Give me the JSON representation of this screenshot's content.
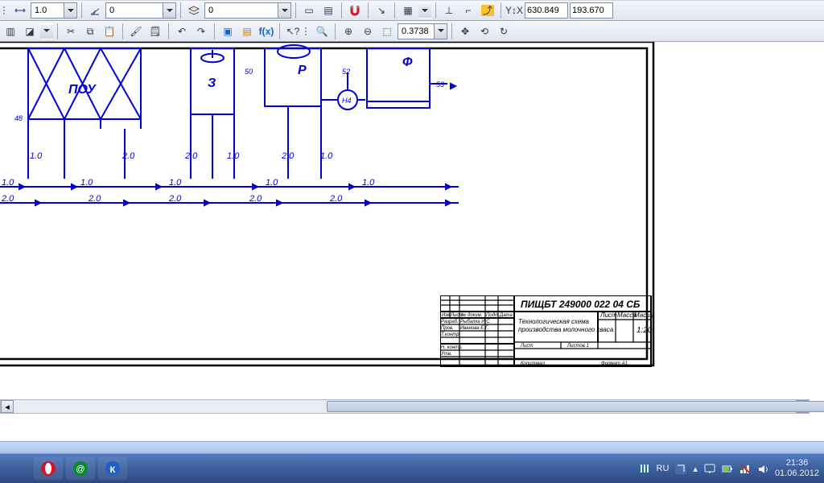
{
  "toolbar1": {
    "scale_steps": "1.0",
    "rotation": "0",
    "offset": "0",
    "coord_x": "630.849",
    "coord_y": "193.670"
  },
  "toolbar2": {
    "zoom": "0.3738"
  },
  "drawing": {
    "labels": {
      "pou": "ПОУ",
      "z": "З",
      "r": "Р",
      "f": "Ф",
      "n4": "Н4"
    },
    "pipe_nums": {
      "n48": "48",
      "n50": "50",
      "n52": "52",
      "n53": "53"
    },
    "flow": {
      "v1": "1.0",
      "v2": "2.0"
    }
  },
  "titleblock": {
    "code": "ПИЩБТ 249000 022 04 СБ",
    "title1": "Технологическая схема",
    "title2": "производства молочного кваса",
    "scale": "1:20",
    "col_list": "Лист",
    "col_mass": "Масса",
    "col_scale": "Масштаб",
    "r1": "Разраб.",
    "r1n": "Рыбалка И.С.",
    "r2": "Пров.",
    "r2n": "Иванова Е.Г.",
    "r3": "Т.контр.",
    "r4": "Н. контр.",
    "r5": "Утв.",
    "sheet": "Лист",
    "sheets": "Листов  1",
    "hdr1": "Изм",
    "hdr2": "Лист",
    "hdr3": "№ докум.",
    "hdr4": "Подп.",
    "hdr5": "Дата",
    "copied": "Копировал",
    "format": "Формат   A1"
  },
  "tray": {
    "lang": "RU",
    "time": "21:36",
    "date": "01.06.2012"
  },
  "taskbar_apps": [
    "opera",
    "mail-agent",
    "kompas"
  ]
}
